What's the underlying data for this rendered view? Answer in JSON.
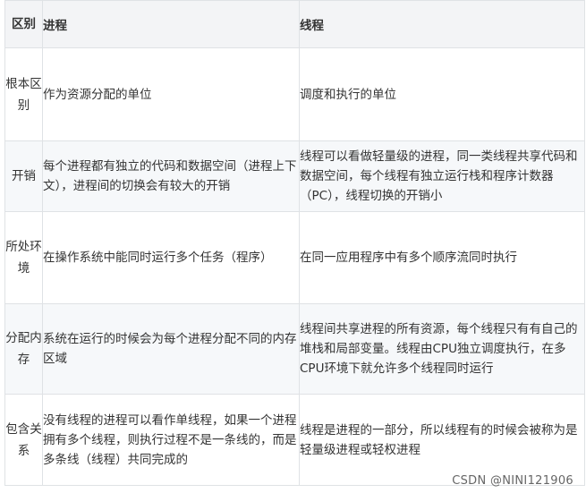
{
  "table": {
    "headers": [
      "区别",
      "进程",
      "线程"
    ],
    "rows": [
      {
        "aspect": "根本区别",
        "process": "作为资源分配的单位",
        "thread": "调度和执行的单位"
      },
      {
        "aspect": "开销",
        "process": "每个进程都有独立的代码和数据空间（进程上下文），进程间的切换会有较大的开销",
        "thread": "线程可以看做轻量级的进程，同一类线程共享代码和数据空间，每个线程有独立运行栈和程序计数器（PC），线程切换的开销小"
      },
      {
        "aspect": "所处环境",
        "process": "在操作系统中能同时运行多个任务（程序）",
        "thread": "在同一应用程序中有多个顺序流同时执行"
      },
      {
        "aspect": "分配内存",
        "process": "系统在运行的时候会为每个进程分配不同的内存区域",
        "thread": "线程间共享进程的所有资源，每个线程只有有自己的堆栈和局部变量。线程由CPU独立调度执行，在多CPU环境下就允许多个线程同时运行"
      },
      {
        "aspect": "包含关系",
        "process": "没有线程的进程可以看作单线程，如果一个进程拥有多个线程，则执行过程不是一条线的，而是多条线（线程）共同完成的",
        "thread": "线程是进程的一部分，所以线程有的时候会被称为是轻量级进程或轻权进程"
      }
    ]
  },
  "watermark": "CSDN @NINI121906"
}
